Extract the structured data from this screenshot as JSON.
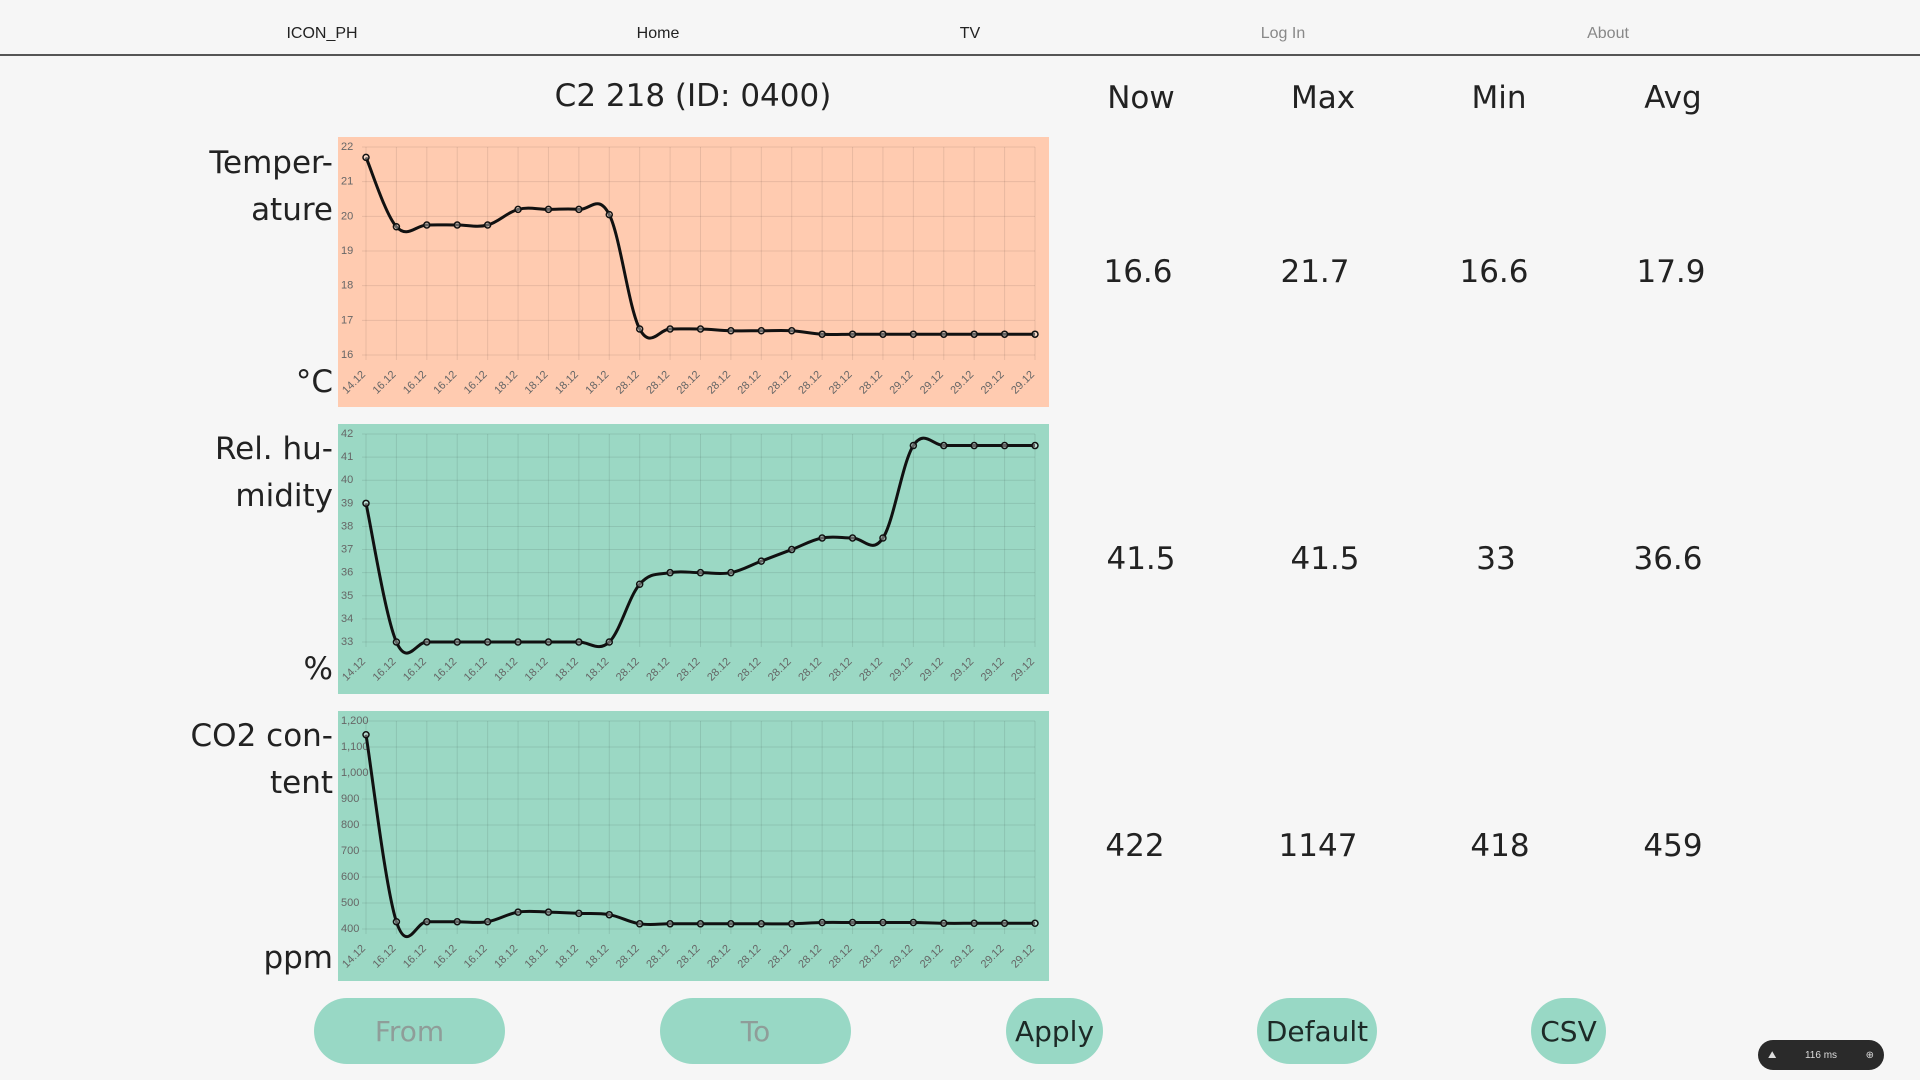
{
  "nav": {
    "brand": "ICON_PH",
    "home": "Home",
    "tv": "TV",
    "login": "Log In",
    "about": "About"
  },
  "title": "C2 218 (ID: 0400)",
  "columns": {
    "now": "Now",
    "max": "Max",
    "min": "Min",
    "avg": "Avg"
  },
  "rows": [
    {
      "label_line1": "Temper-",
      "label_line2": "ature",
      "unit": "°C",
      "now": "16.6",
      "max": "21.7",
      "min": "16.6",
      "avg": "17.9"
    },
    {
      "label_line1": "Rel. hu-",
      "label_line2": "midity",
      "unit": "%",
      "now": "41.5",
      "max": "41.5",
      "min": "33",
      "avg": "36.6"
    },
    {
      "label_line1": "CO2 con-",
      "label_line2": "tent",
      "unit": "ppm",
      "now": "422",
      "max": "1147",
      "min": "418",
      "avg": "459"
    }
  ],
  "buttons": {
    "from": "From",
    "to": "To",
    "apply": "Apply",
    "default": "Default",
    "csv": "CSV"
  },
  "perf": {
    "value": "116",
    "unit": "ms"
  },
  "colors": {
    "temperature_bg": "#ffcbb0",
    "humidity_bg": "#9bd8c4",
    "co2_bg": "#9bd8c4",
    "line": "#111111",
    "button": "#98d8c5"
  },
  "chart_data": [
    {
      "type": "line",
      "x": [
        "14.12",
        "16.12",
        "16.12",
        "16.12",
        "16.12",
        "18.12",
        "18.12",
        "18.12",
        "18.12",
        "28.12",
        "28.12",
        "28.12",
        "28.12",
        "28.12",
        "28.12",
        "28.12",
        "28.12",
        "28.12",
        "29.12",
        "29.12",
        "29.12",
        "29.12",
        "29.12"
      ],
      "y": [
        21.7,
        19.7,
        19.75,
        19.75,
        19.75,
        20.2,
        20.2,
        20.2,
        20.05,
        16.75,
        16.75,
        16.75,
        16.7,
        16.7,
        16.7,
        16.6,
        16.6,
        16.6,
        16.6,
        16.6,
        16.6,
        16.6,
        16.6
      ],
      "yticks": [
        16,
        17,
        18,
        19,
        20,
        21,
        22
      ],
      "ylim": [
        16,
        22
      ],
      "grid": true,
      "curve": "smooth"
    },
    {
      "type": "line",
      "x": [
        "14.12",
        "16.12",
        "16.12",
        "16.12",
        "16.12",
        "18.12",
        "18.12",
        "18.12",
        "18.12",
        "28.12",
        "28.12",
        "28.12",
        "28.12",
        "28.12",
        "28.12",
        "28.12",
        "28.12",
        "28.12",
        "29.12",
        "29.12",
        "29.12",
        "29.12",
        "29.12"
      ],
      "y": [
        39,
        33,
        33,
        33,
        33,
        33,
        33,
        33,
        33,
        35.5,
        36,
        36,
        36,
        36.5,
        37,
        37.5,
        37.5,
        37.5,
        41.5,
        41.5,
        41.5,
        41.5,
        41.5
      ],
      "yticks": [
        33,
        34,
        35,
        36,
        37,
        38,
        39,
        40,
        41,
        42
      ],
      "ylim": [
        33,
        42
      ],
      "grid": true,
      "curve": "smooth"
    },
    {
      "type": "line",
      "x": [
        "14.12",
        "16.12",
        "16.12",
        "16.12",
        "16.12",
        "18.12",
        "18.12",
        "18.12",
        "18.12",
        "28.12",
        "28.12",
        "28.12",
        "28.12",
        "28.12",
        "28.12",
        "28.12",
        "28.12",
        "28.12",
        "29.12",
        "29.12",
        "29.12",
        "29.12",
        "29.12"
      ],
      "y": [
        1147,
        428,
        428,
        428,
        428,
        465,
        465,
        460,
        455,
        420,
        420,
        420,
        420,
        420,
        420,
        425,
        425,
        425,
        425,
        422,
        422,
        422,
        422
      ],
      "yticks": [
        400,
        500,
        600,
        700,
        800,
        900,
        1000,
        1100,
        1200
      ],
      "yticklabels": [
        "400",
        "500",
        "600",
        "700",
        "800",
        "900",
        "1,000",
        "1,100",
        "1,200"
      ],
      "ylim": [
        400,
        1200
      ],
      "grid": true,
      "curve": "smooth"
    }
  ]
}
